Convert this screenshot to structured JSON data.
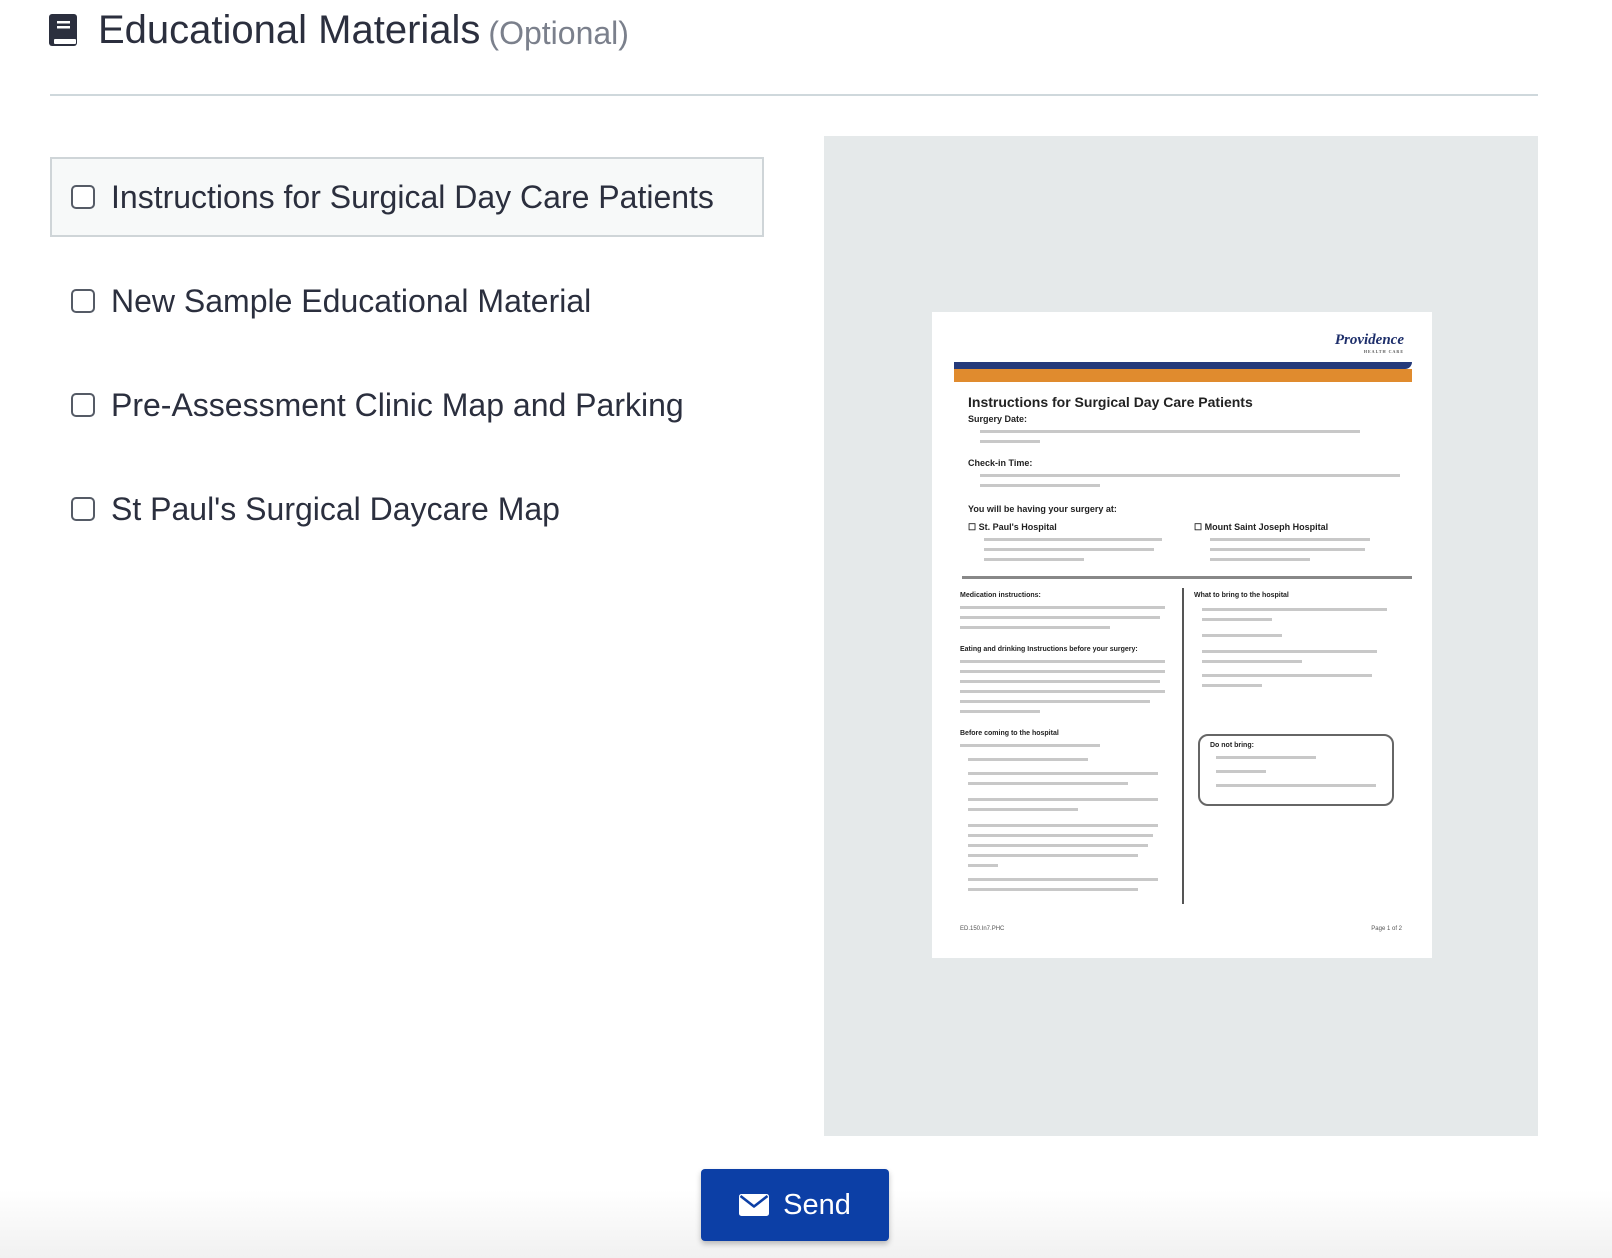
{
  "header": {
    "title": "Educational Materials",
    "optional": "(Optional)",
    "icon": "book-icon"
  },
  "materials": [
    {
      "label": "Instructions for Surgical Day Care Patients",
      "checked": false,
      "selected": true
    },
    {
      "label": "New Sample Educational Material",
      "checked": false,
      "selected": false
    },
    {
      "label": "Pre-Assessment Clinic Map and Parking",
      "checked": false,
      "selected": false
    },
    {
      "label": "St Paul's Surgical Daycare Map",
      "checked": false,
      "selected": false
    }
  ],
  "preview": {
    "doc_title": "Instructions for Surgical Day Care Patients",
    "logo": "Providence",
    "logo_sub": "HEALTH CARE",
    "surgery_date": "Surgery Date:",
    "check_in": "Check-in Time:",
    "having_at": "You will be having your surgery at:",
    "hospital_1": "St. Paul's Hospital",
    "hospital_2": "Mount Saint Joseph Hospital",
    "medication": "Medication instructions:",
    "eating": "Eating and drinking Instructions before your surgery:",
    "before": "Before coming to the hospital",
    "bring": "What to bring to the hospital",
    "do_not_bring": "Do not bring:",
    "page": "Page 1 of 2"
  },
  "actions": {
    "send_label": "Send",
    "send_icon": "envelope-icon"
  },
  "colors": {
    "primary": "#0c3fa6",
    "text": "#2b2f3e",
    "muted": "#7b808c",
    "preview_bg": "#e5e9ea"
  }
}
